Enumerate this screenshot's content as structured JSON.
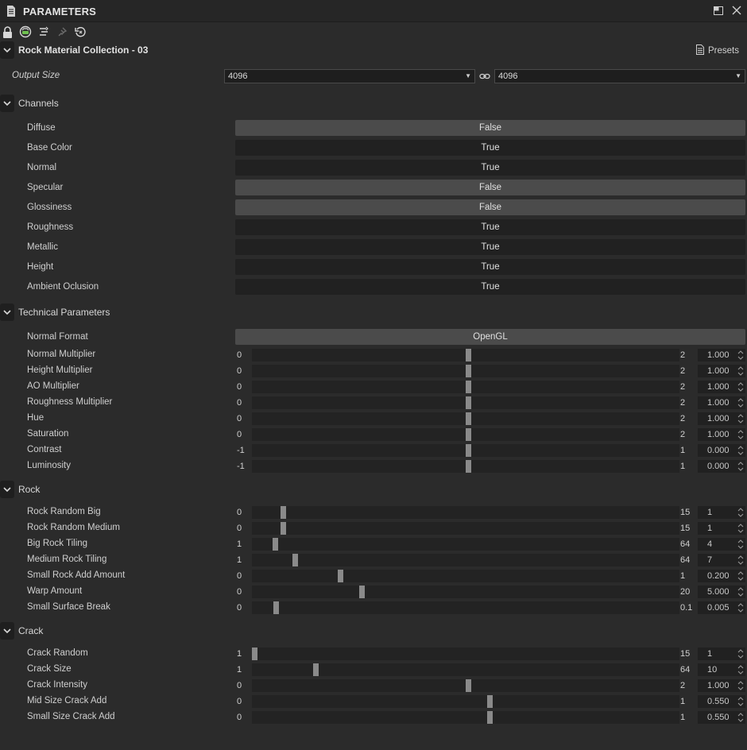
{
  "panel": {
    "title": "PARAMETERS"
  },
  "header": {
    "title": "Rock Material Collection - 03",
    "presets_label": "Presets"
  },
  "output_size": {
    "label": "Output Size",
    "width": "4096",
    "height": "4096"
  },
  "channels": {
    "title": "Channels",
    "items": [
      {
        "label": "Diffuse",
        "value": "False"
      },
      {
        "label": "Base Color",
        "value": "True"
      },
      {
        "label": "Normal",
        "value": "True"
      },
      {
        "label": "Specular",
        "value": "False"
      },
      {
        "label": "Glossiness",
        "value": "False"
      },
      {
        "label": "Roughness",
        "value": "True"
      },
      {
        "label": "Metallic",
        "value": "True"
      },
      {
        "label": "Height",
        "value": "True"
      },
      {
        "label": "Ambient Oclusion",
        "value": "True"
      }
    ]
  },
  "technical": {
    "title": "Technical Parameters",
    "normal_format": {
      "label": "Normal Format",
      "value": "OpenGL"
    },
    "sliders": [
      {
        "label": "Normal Multiplier",
        "min": "0",
        "max": "2",
        "value": "1.000",
        "fraction": 0.5
      },
      {
        "label": "Height Multiplier",
        "min": "0",
        "max": "2",
        "value": "1.000",
        "fraction": 0.5
      },
      {
        "label": "AO Multiplier",
        "min": "0",
        "max": "2",
        "value": "1.000",
        "fraction": 0.5
      },
      {
        "label": "Roughness Multiplier",
        "min": "0",
        "max": "2",
        "value": "1.000",
        "fraction": 0.5
      },
      {
        "label": "Hue",
        "min": "0",
        "max": "2",
        "value": "1.000",
        "fraction": 0.5
      },
      {
        "label": "Saturation",
        "min": "0",
        "max": "2",
        "value": "1.000",
        "fraction": 0.5
      },
      {
        "label": "Contrast",
        "min": "-1",
        "max": "1",
        "value": "0.000",
        "fraction": 0.5
      },
      {
        "label": "Luminosity",
        "min": "-1",
        "max": "1",
        "value": "0.000",
        "fraction": 0.5
      }
    ]
  },
  "rock": {
    "title": "Rock",
    "sliders": [
      {
        "label": "Rock Random Big",
        "min": "0",
        "max": "15",
        "value": "1",
        "fraction": 0.0667
      },
      {
        "label": "Rock Random Medium",
        "min": "0",
        "max": "15",
        "value": "1",
        "fraction": 0.0667
      },
      {
        "label": "Big Rock Tiling",
        "min": "1",
        "max": "64",
        "value": "4",
        "fraction": 0.0476
      },
      {
        "label": "Medium Rock Tiling",
        "min": "1",
        "max": "64",
        "value": "7",
        "fraction": 0.0952
      },
      {
        "label": "Small Rock Add Amount",
        "min": "0",
        "max": "1",
        "value": "0.200",
        "fraction": 0.2
      },
      {
        "label": "Warp Amount",
        "min": "0",
        "max": "20",
        "value": "5.000",
        "fraction": 0.25
      },
      {
        "label": "Small Surface Break",
        "min": "0",
        "max": "0.1",
        "value": "0.005",
        "fraction": 0.05
      }
    ]
  },
  "crack": {
    "title": "Crack",
    "sliders": [
      {
        "label": "Crack Random",
        "min": "1",
        "max": "15",
        "value": "1",
        "fraction": 0.0
      },
      {
        "label": "Crack Size",
        "min": "1",
        "max": "64",
        "value": "10",
        "fraction": 0.1429
      },
      {
        "label": "Crack Intensity",
        "min": "0",
        "max": "2",
        "value": "1.000",
        "fraction": 0.5
      },
      {
        "label": "Mid Size Crack Add",
        "min": "0",
        "max": "1",
        "value": "0.550",
        "fraction": 0.55
      },
      {
        "label": "Small Size Crack Add",
        "min": "0",
        "max": "1",
        "value": "0.550",
        "fraction": 0.55
      }
    ]
  },
  "colors": {
    "background": "#2b2b2b",
    "toggle_on": "#212121",
    "toggle_off": "#4b4b4b",
    "thumb": "#8a8a8a"
  }
}
